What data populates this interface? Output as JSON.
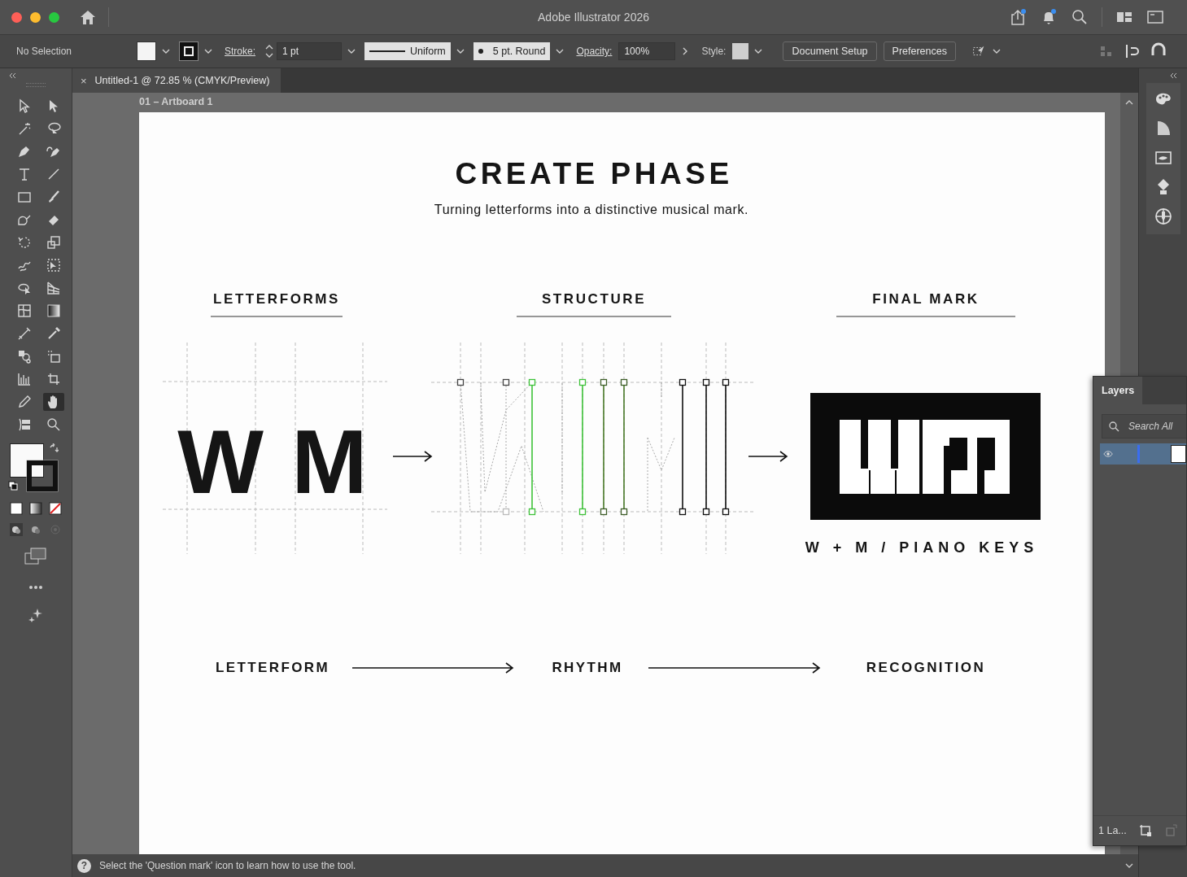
{
  "window": {
    "title": "Adobe Illustrator 2026"
  },
  "control_bar": {
    "selection": "No Selection",
    "stroke_label": "Stroke:",
    "stroke_weight": "1 pt",
    "profile": "Uniform",
    "brush": "5 pt. Round",
    "opacity_label": "Opacity:",
    "opacity": "100%",
    "style_label": "Style:",
    "buttons": [
      "Document Setup",
      "Preferences"
    ]
  },
  "toolbar": {
    "tools": [
      {
        "kind": "pointer",
        "selected": false
      },
      {
        "kind": "solid-pointer",
        "selected": false
      },
      {
        "kind": "wand",
        "selected": false
      },
      {
        "kind": "lasso",
        "selected": false
      },
      {
        "kind": "pen",
        "selected": false
      },
      {
        "kind": "curvature-pen",
        "selected": false
      },
      {
        "kind": "type",
        "selected": false
      },
      {
        "kind": "line",
        "selected": false
      },
      {
        "kind": "rectangle",
        "selected": false
      },
      {
        "kind": "brush",
        "selected": false
      },
      {
        "kind": "shaper",
        "selected": false
      },
      {
        "kind": "eraser",
        "selected": false
      },
      {
        "kind": "rotate",
        "selected": false
      },
      {
        "kind": "scale",
        "selected": false
      },
      {
        "kind": "warp",
        "selected": false
      },
      {
        "kind": "free-transform",
        "selected": false
      },
      {
        "kind": "shape-builder",
        "selected": false
      },
      {
        "kind": "perspective-grid",
        "selected": false
      },
      {
        "kind": "mesh",
        "selected": false
      },
      {
        "kind": "gradient",
        "selected": false
      },
      {
        "kind": "blend",
        "selected": false
      },
      {
        "kind": "eyedropper",
        "selected": false
      },
      {
        "kind": "symbol-sprayer",
        "selected": false
      },
      {
        "kind": "live-paint",
        "selected": false
      },
      {
        "kind": "bar-chart",
        "selected": false
      },
      {
        "kind": "artboard",
        "selected": false
      },
      {
        "kind": "pencil",
        "selected": false
      },
      {
        "kind": "hand",
        "selected": true
      },
      {
        "kind": "flag",
        "selected": false
      },
      {
        "kind": "zoom",
        "selected": false
      }
    ]
  },
  "document_tab": {
    "close": "×",
    "title": "Untitled-1 @ 72.85 % (CMYK/Preview)"
  },
  "artboard": {
    "label": "01 – Artboard 1",
    "title": "CREATE PHASE",
    "subtitle": "Turning letterforms into a distinctive musical mark.",
    "sections": [
      {
        "heading": "LETTERFORMS"
      },
      {
        "heading": "STRUCTURE"
      },
      {
        "heading": "FINAL MARK"
      }
    ],
    "letters": [
      "W",
      "M"
    ],
    "mark_caption": "W + M / PIANO KEYS",
    "flow": [
      "LETTERFORM",
      "RHYTHM",
      "RECOGNITION"
    ]
  },
  "layers_panel": {
    "title": "Layers",
    "search_placeholder": "Search All",
    "layers": [
      {
        "selected": true
      }
    ],
    "count": "1 La..."
  },
  "status_bar": {
    "help": "?",
    "message": "Select the 'Question mark' icon to learn how to use the tool."
  }
}
